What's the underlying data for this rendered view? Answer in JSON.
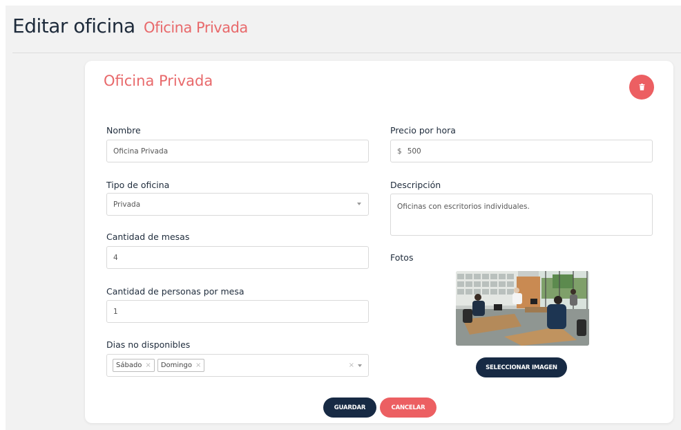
{
  "header": {
    "title": "Editar oficina",
    "subtitle": "Oficina Privada"
  },
  "card": {
    "title": "Oficina Privada",
    "delete_icon": "trash-icon"
  },
  "form": {
    "nombre": {
      "label": "Nombre",
      "value": "Oficina Privada"
    },
    "tipo": {
      "label": "Tipo de oficina",
      "value": "Privada"
    },
    "mesas": {
      "label": "Cantidad de mesas",
      "value": "4"
    },
    "personas": {
      "label": "Cantidad de personas por mesa",
      "value": "1"
    },
    "dias": {
      "label": "Dias no disponibles",
      "tags": [
        "Sábado",
        "Domingo"
      ],
      "remove_glyph": "×",
      "clear_glyph": "×"
    },
    "precio": {
      "label": "Precio por hora",
      "currency": "$",
      "value": "500"
    },
    "descripcion": {
      "label": "Descripción",
      "value": "Oficinas con escritorios individuales."
    },
    "fotos": {
      "label": "Fotos",
      "button": "SELECCIONAR IMAGEN"
    }
  },
  "actions": {
    "save": "GUARDAR",
    "cancel": "CANCELAR"
  },
  "colors": {
    "accent": "#e8696b",
    "danger": "#ec5f62",
    "primary_dark": "#172a44",
    "page_bg": "#f2f2f2"
  }
}
